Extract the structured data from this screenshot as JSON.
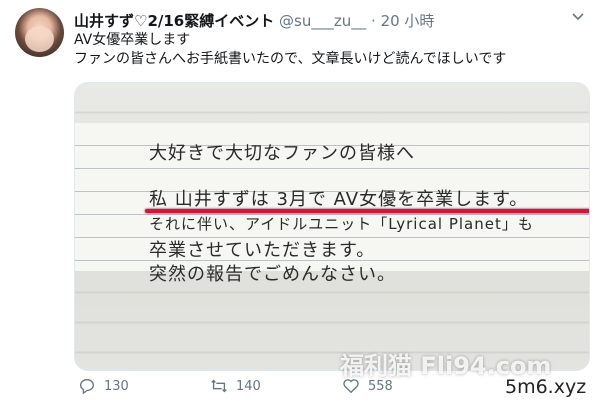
{
  "tweet": {
    "display_name": "山井すず♡2/16緊縛イベント",
    "handle": "@su___zu__",
    "separator": "·",
    "time": "20 小時",
    "text_line1": "AV女優卒業します",
    "text_line2": "ファンの皆さんへお手紙書いたので、文章長いけど読んでほしいです"
  },
  "letter": {
    "line1": "大好きで大切なファンの皆様へ",
    "line2": "私 山井すずは 3月で AV女優を卒業します。",
    "line3": "それに伴い、アイドルユニット「Lyrical Planet」も",
    "line4": "卒業させていただきます。",
    "line5": "突然の報告でごめんなさい。"
  },
  "actions": {
    "replies": "130",
    "retweets": "140",
    "likes": "558"
  },
  "watermark": {
    "site_text": "福利猫 Fli94.com",
    "corner_text": "5m6.xyz"
  },
  "colors": {
    "accent_red": "#d4143c",
    "meta_gray": "#657786"
  }
}
